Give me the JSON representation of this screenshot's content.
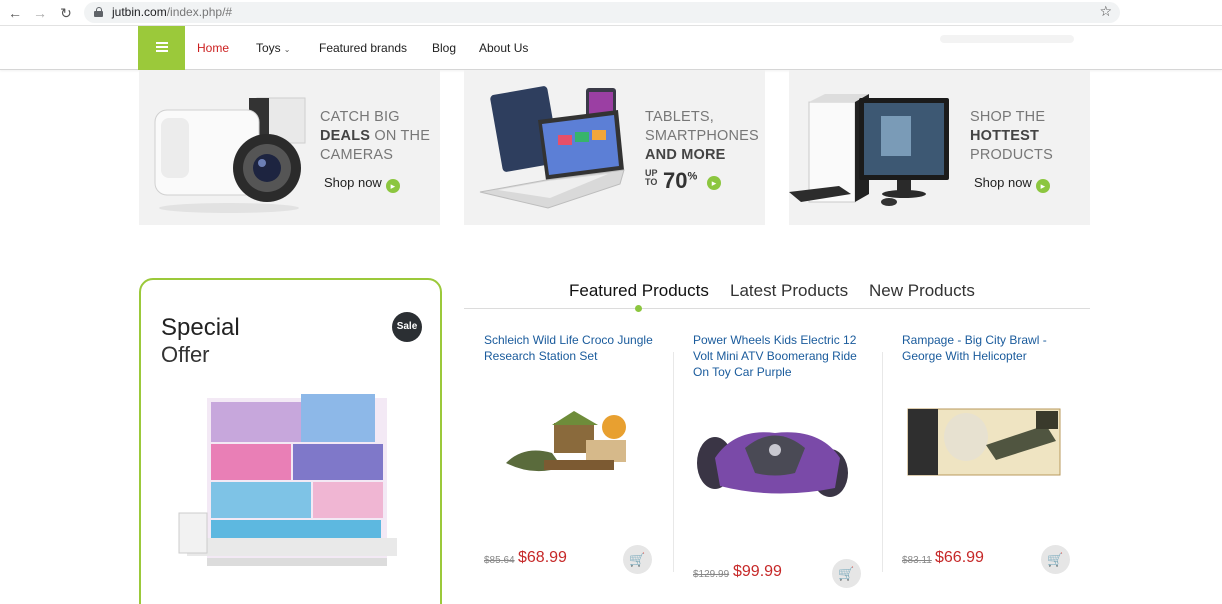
{
  "browser": {
    "url_host": "jutbin.com",
    "url_path": "/index.php/#"
  },
  "nav": {
    "items": [
      "Home",
      "Toys",
      "Featured brands",
      "Blog",
      "About Us"
    ]
  },
  "banners": [
    {
      "line1": "CATCH BIG",
      "line2_bold": "DEALS",
      "line2_rest": " ON THE",
      "line3": "CAMERAS",
      "cta": "Shop now"
    },
    {
      "line1": "TABLETS,",
      "line2": "SMARTPHONES",
      "line3_bold": "AND MORE",
      "up": "UP",
      "to": "TO",
      "percent": "70",
      "percent_sign": "%"
    },
    {
      "line1": "SHOP THE",
      "line2_bold": "HOTTEST",
      "line3": "PRODUCTS",
      "cta": "Shop now"
    }
  ],
  "special_offer": {
    "line1": "Special",
    "line2": "Offer",
    "badge": "Sale"
  },
  "tabs": [
    "Featured Products",
    "Latest Products",
    "New Products"
  ],
  "products": [
    {
      "title_l1": "Schleich Wild Life Croco Jungle",
      "title_l2": "Research Station Set",
      "title_l3": "",
      "old_price": "$85.64",
      "price": "$68.99"
    },
    {
      "title_l1": "Power Wheels Kids Electric 12",
      "title_l2": "Volt Mini ATV Boomerang Ride",
      "title_l3": "On Toy Car Purple",
      "old_price": "$129.99",
      "price": "$99.99"
    },
    {
      "title_l1": "Rampage - Big City Brawl -",
      "title_l2": "George With Helicopter",
      "title_l3": "",
      "old_price": "$83.11",
      "price": "$66.99"
    }
  ],
  "colors": {
    "accent": "#9bc93a",
    "price": "#c62828",
    "link": "#1a5b9c",
    "active_nav": "#cc1f1f"
  }
}
